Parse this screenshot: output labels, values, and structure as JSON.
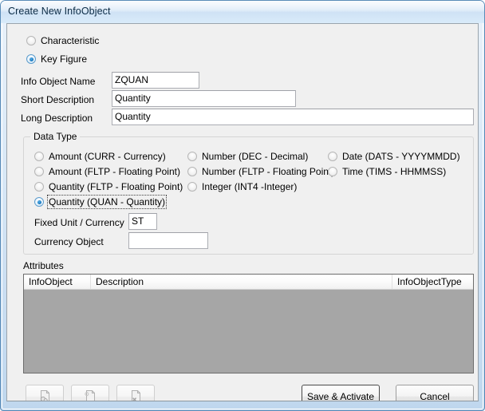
{
  "window": {
    "title": "Create New InfoObject"
  },
  "object_type": {
    "options": [
      {
        "label": "Characteristic",
        "selected": false
      },
      {
        "label": "Key Figure",
        "selected": true
      }
    ]
  },
  "form": {
    "info_object_name": {
      "label": "Info Object Name",
      "value": "ZQUAN",
      "placeholder": ""
    },
    "short_description": {
      "label": "Short Description",
      "value": "Quantity",
      "placeholder": ""
    },
    "long_description": {
      "label": "Long Description",
      "value": "Quantity",
      "placeholder": ""
    }
  },
  "data_type": {
    "legend": "Data Type",
    "column1": [
      {
        "label": "Amount (CURR - Currency)",
        "selected": false
      },
      {
        "label": "Amount (FLTP - Floating Point)",
        "selected": false
      },
      {
        "label": "Quantity (FLTP - Floating Point)",
        "selected": false
      },
      {
        "label": "Quantity (QUAN - Quantity)",
        "selected": true,
        "focused": true
      }
    ],
    "column2": [
      {
        "label": "Number (DEC - Decimal)",
        "selected": false
      },
      {
        "label": "Number (FLTP - Floating Point)",
        "selected": false
      },
      {
        "label": "Integer (INT4 -Integer)",
        "selected": false
      }
    ],
    "column3": [
      {
        "label": "Date (DATS - YYYYMMDD)",
        "selected": false
      },
      {
        "label": "Time (TIMS - HHMMSS)",
        "selected": false
      }
    ],
    "fixed_unit": {
      "label": "Fixed Unit / Currency",
      "value": "ST",
      "placeholder": ""
    },
    "currency_object": {
      "label": "Currency Object",
      "value": "",
      "placeholder": ""
    }
  },
  "attributes": {
    "legend": "Attributes",
    "columns": [
      "InfoObject",
      "Description",
      "InfoObjectType"
    ],
    "rows": []
  },
  "toolbar": {
    "buttons": [
      {
        "name": "attribute-lookup-button",
        "icon": "document-search-icon",
        "enabled": false
      },
      {
        "name": "new-attribute-button",
        "icon": "document-new-icon",
        "enabled": false
      },
      {
        "name": "delete-attribute-button",
        "icon": "document-delete-icon",
        "enabled": false
      }
    ]
  },
  "actions": {
    "save": "Save & Activate",
    "cancel": "Cancel"
  },
  "colors": {
    "titlebar_text": "#0b2b45",
    "client_bg": "#f0f0f0",
    "table_body": "#a6a6a6",
    "radio_dot": "#0d6fb8"
  }
}
